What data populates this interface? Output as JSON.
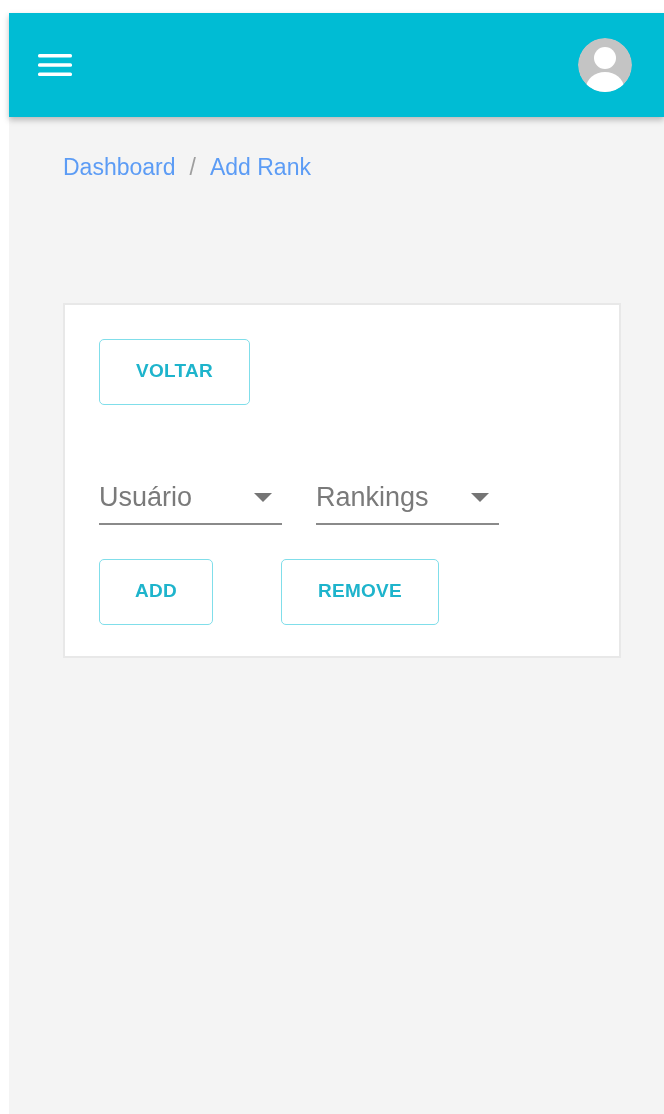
{
  "breadcrumb": [
    {
      "label": "Dashboard"
    },
    {
      "label": "/",
      "kind": "separator"
    },
    {
      "label": "Add Rank"
    }
  ],
  "card": {
    "back_button": "VOLTAR",
    "selects": [
      {
        "placeholder": "Usuário"
      },
      {
        "placeholder": "Rankings"
      }
    ],
    "buttons": [
      "ADD",
      "REMOVE"
    ]
  }
}
